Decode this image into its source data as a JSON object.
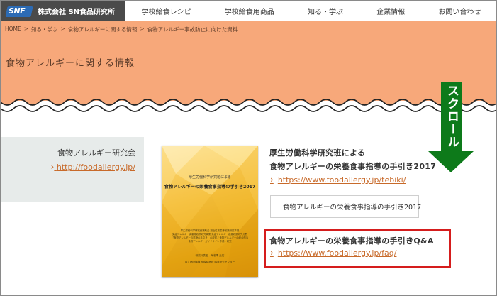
{
  "header": {
    "logo_text": "SNF",
    "company": "株式会社 SN食品研究所",
    "nav": [
      "学校給食レシピ",
      "学校給食用商品",
      "知る・学ぶ",
      "企業情報",
      "お問い合わせ"
    ]
  },
  "breadcrumb": [
    "HOME",
    "知る・学ぶ",
    "食物アレルギーに関する情報",
    "食物アレルギー事故防止に向けた資料"
  ],
  "breadcrumb_sep": ">",
  "page_title": "食物アレルギーに関する情報",
  "sidebar": {
    "title": "食物アレルギー研究会",
    "link": "http://foodallergy.jp/"
  },
  "book": {
    "small": "厚生労働科学研究班による",
    "title": "食物アレルギーの栄養食事指導の手引き2017",
    "fine": [
      "厚生労働科学研究費補助金 難治性疾患等政策研究事業",
      "免疫アレルギー疾患等政策研究事業 免疫アレルギー疾患政策研究分野",
      "「食物アレルギーの診療の手引き」の改訂と食物アレルギーの総合的な",
      "食物アレルギーガイドライン作成・研究"
    ],
    "foot1": "研究代表者　海老澤 元宏",
    "foot2": "国立病院機構 相模原病院 臨床研究センター"
  },
  "info": {
    "heading_line1": "厚生労働科学研究班による",
    "heading_line2": "食物アレルギーの栄養食事指導の手引き2017",
    "link1": "https://www.foodallergy.jp/tebiki/",
    "pdf_label": "食物アレルギーの栄養食事指導の手引き2017",
    "qa_heading": "食物アレルギーの栄養食事指導の手引きQ&A",
    "link2": "https://www.foodallergy.jp/faq/"
  },
  "annotation": {
    "scroll_label": "スクロール"
  },
  "colors": {
    "hero": "#f7a87a",
    "link": "#c86a2a",
    "highlight": "#d51d1d",
    "arrow": "#0d7a1a",
    "brand_bar": "#4a4a4a"
  }
}
